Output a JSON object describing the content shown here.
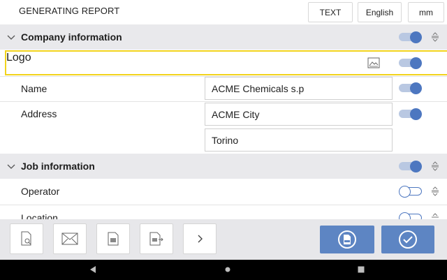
{
  "header": {
    "title": "GENERATING REPORT",
    "buttons": {
      "text": "TEXT",
      "language": "English",
      "unit": "mm"
    }
  },
  "sections": {
    "company": {
      "label": "Company information",
      "enabled": true
    },
    "job": {
      "label": "Job information",
      "enabled": true
    }
  },
  "company_rows": {
    "logo": {
      "label": "Logo",
      "enabled": true
    },
    "name": {
      "label": "Name",
      "value": "ACME Chemicals s.p",
      "enabled": true
    },
    "address": {
      "label": "Address",
      "value_line1": "ACME City",
      "value_line2": "Torino",
      "enabled": true
    }
  },
  "job_rows": {
    "operator": {
      "label": "Operator",
      "enabled": false
    },
    "location": {
      "label": "Location",
      "enabled": false
    }
  },
  "colors": {
    "accent": "#4d77c0",
    "highlight": "#f2d31c",
    "primary_button": "#5d85c3"
  },
  "toolbar": {
    "icons": [
      "preview-document-icon",
      "email-icon",
      "report-icon",
      "export-icon",
      "chevron-right-icon",
      "pdf-icon",
      "confirm-check-icon"
    ]
  },
  "navbar": {
    "icons": [
      "back-icon",
      "home-icon",
      "recents-icon"
    ]
  }
}
